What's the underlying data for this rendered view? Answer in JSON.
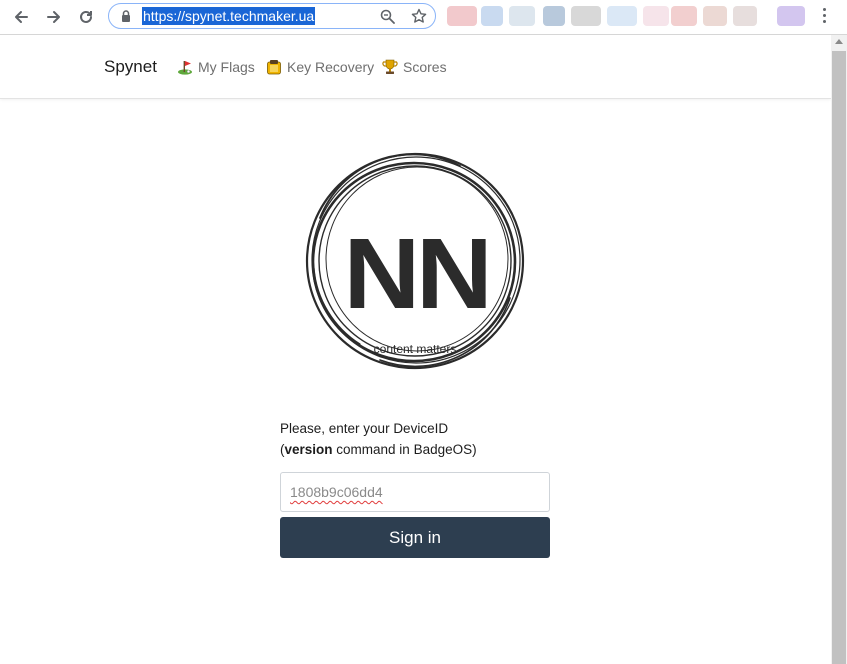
{
  "browser": {
    "url": "https://spynet.techmaker.ua",
    "icons": [
      "back-icon",
      "forward-icon",
      "reload-icon",
      "lock-icon",
      "zoom-icon",
      "star-icon",
      "menu-icon"
    ]
  },
  "navbar": {
    "brand": "Spynet",
    "links": [
      {
        "label": "My Flags",
        "icon": "golf-flag-icon"
      },
      {
        "label": "Key Recovery",
        "icon": "key-clipboard-icon"
      },
      {
        "label": "Scores",
        "icon": "trophy-icon"
      }
    ]
  },
  "logo": {
    "text": "NN",
    "tagline": "content matters"
  },
  "login": {
    "prompt_line1": "Please, enter your DeviceID",
    "prompt_open": "(",
    "prompt_cmd": "version",
    "prompt_rest": " command in BadgeOS)",
    "device_id_value": "1808b9c06dd4",
    "submit_label": "Sign in"
  },
  "colors": {
    "button_bg": "#2d3e50",
    "url_highlight": "#1a66d6",
    "link_text": "#6f6f6f"
  }
}
